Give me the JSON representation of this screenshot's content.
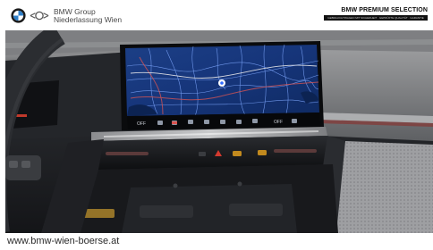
{
  "header": {
    "dealer_line1": "BMW Group",
    "dealer_line2": "Niederlassung Wien",
    "program_title": "BMW PREMIUM SELECTION",
    "program_tagline": "GEBRAUCHTWAGEN MIT SICHERHEIT · GEPRÜFTE QUALITÄT · GARANTIE"
  },
  "photo": {
    "subject": "BMW curved display showing navigation map",
    "screen": {
      "temp_left": "OFF",
      "temp_right": "OFF"
    }
  },
  "footer": {
    "url": "www.bmw-wien-boerse.at"
  },
  "colors": {
    "header_bg": "#ffffff",
    "map_bg": "#13306b",
    "dash_dark": "#1b1d21"
  },
  "icons": [
    "bmw-logo-icon",
    "mini-logo-icon",
    "location-pin-icon"
  ]
}
